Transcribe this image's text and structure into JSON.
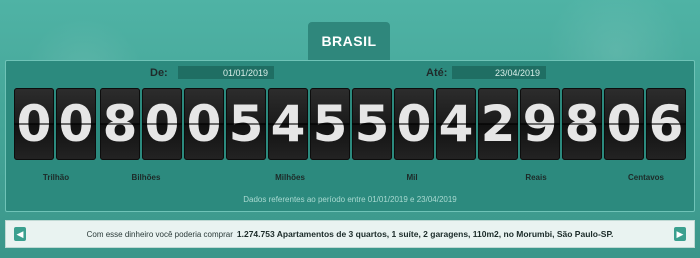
{
  "header": {
    "tab_label": "BRASIL"
  },
  "dates": {
    "from_label": "De:",
    "from_value": "01/01/2019",
    "to_label": "Até:",
    "to_value": "23/04/2019"
  },
  "digits": [
    "0",
    "0",
    "8",
    "0",
    "0",
    "5",
    "4",
    "5",
    "5",
    "0",
    "4",
    "2",
    "9",
    "8",
    "0",
    "6"
  ],
  "units": {
    "trilhao": "Trilhão",
    "bilhoes": "Bilhões",
    "milhoes": "Milhões",
    "mil": "Mil",
    "reais": "Reais",
    "centavos": "Centavos"
  },
  "note": "Dados referentes ao período entre 01/01/2019 e 23/04/2019",
  "banner": {
    "prefix": "Com esse dinheiro você poderia comprar",
    "highlight": "1.274.753 Apartamentos de 3 quartos, 1 suíte, 2 garagens, 110m2, no Morumbi, São Paulo-SP.",
    "prev_icon": "chevron-left-icon",
    "next_icon": "chevron-right-icon"
  }
}
